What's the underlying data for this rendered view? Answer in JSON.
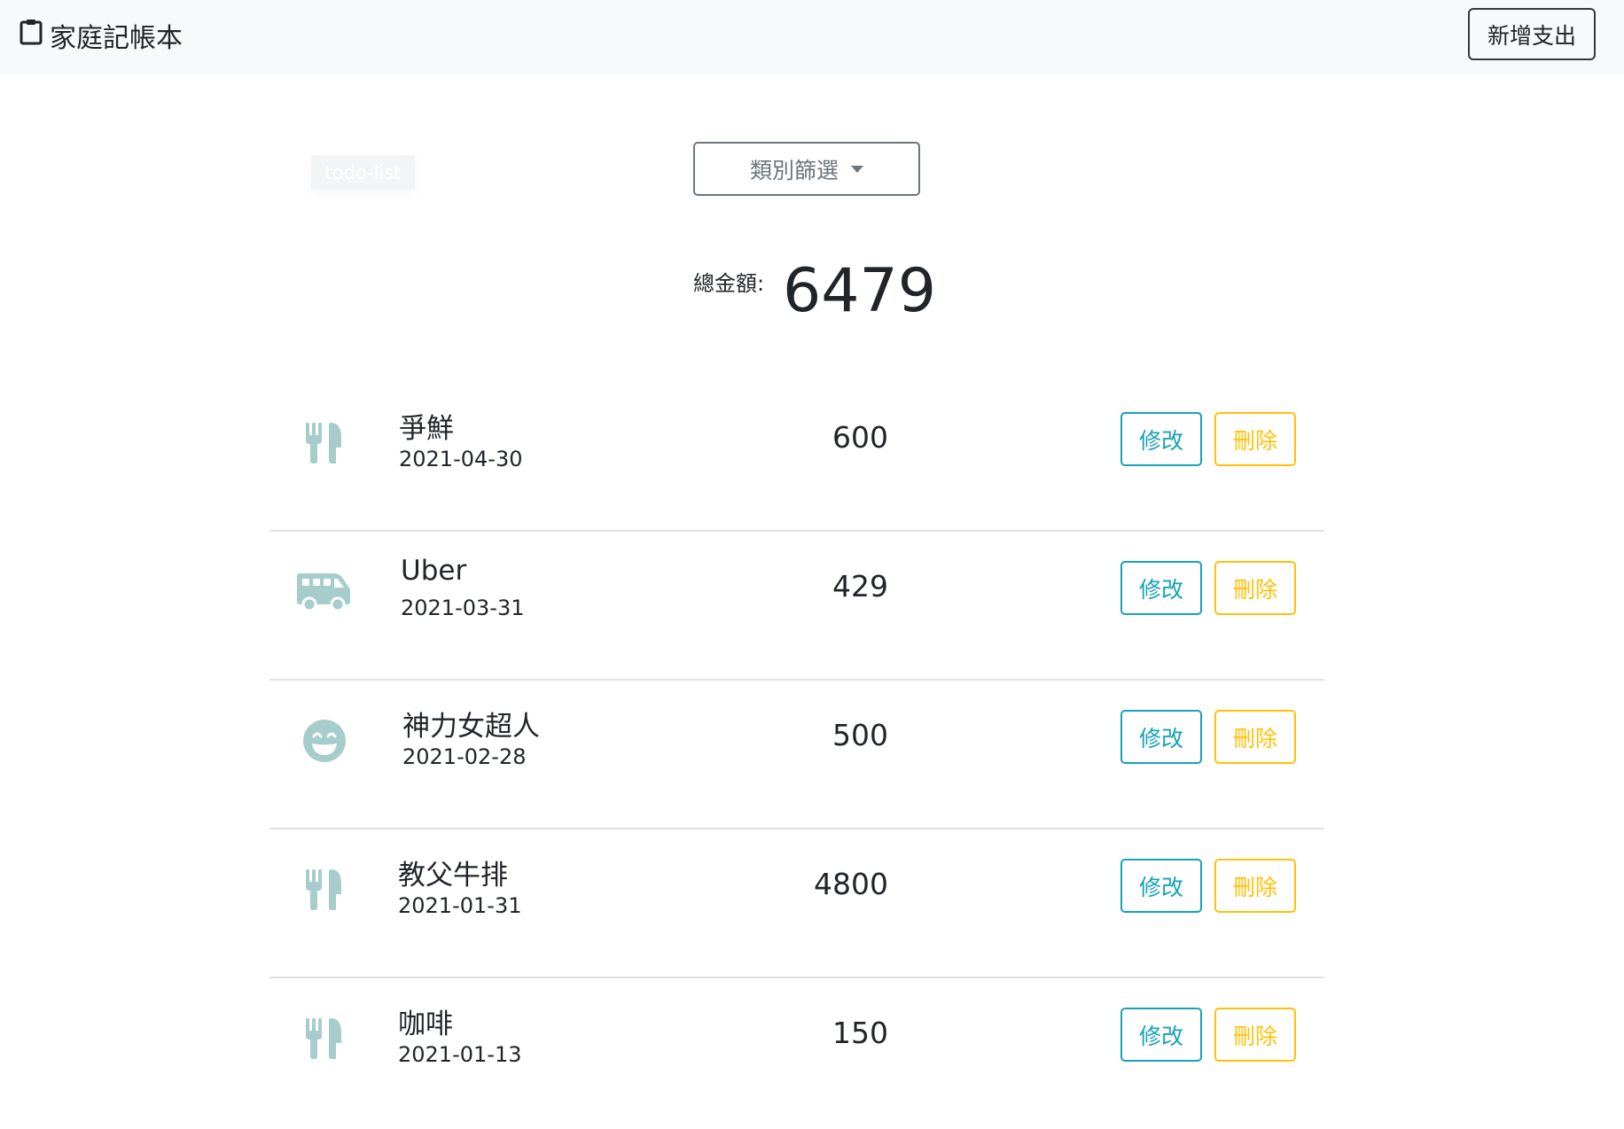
{
  "navbar": {
    "brand": "家庭記帳本",
    "brand_icon": "clipboard-icon",
    "add_button": "新增支出"
  },
  "tag": "todo-list",
  "filter": {
    "label": "類別篩選"
  },
  "total": {
    "label": "總金額:",
    "amount": "6479"
  },
  "colors": {
    "icon": "#a6cdcc",
    "edit": "#17a2b8",
    "delete": "#ffc107"
  },
  "expenses": [
    {
      "icon": "utensils-icon",
      "name": "爭鮮",
      "date": "2021-04-30",
      "amount": "600",
      "edit": "修改",
      "delete": "刪除"
    },
    {
      "icon": "shuttle-van-icon",
      "name": "Uber",
      "date": "2021-03-31",
      "amount": "429",
      "edit": "修改",
      "delete": "刪除"
    },
    {
      "icon": "grin-icon",
      "name": "神力女超人",
      "date": "2021-02-28",
      "amount": "500",
      "edit": "修改",
      "delete": "刪除"
    },
    {
      "icon": "utensils-icon",
      "name": "教父牛排",
      "date": "2021-01-31",
      "amount": "4800",
      "edit": "修改",
      "delete": "刪除"
    },
    {
      "icon": "utensils-icon",
      "name": "咖啡",
      "date": "2021-01-13",
      "amount": "150",
      "edit": "修改",
      "delete": "刪除"
    }
  ]
}
